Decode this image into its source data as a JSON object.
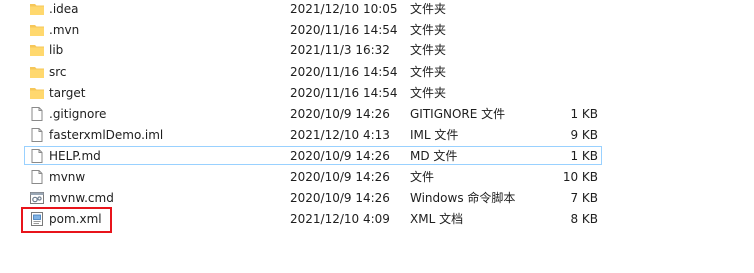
{
  "files": [
    {
      "name": ".idea",
      "date": "2021/12/10 10:05",
      "type": "文件夹",
      "size": "",
      "icon": "folder-icon"
    },
    {
      "name": ".mvn",
      "date": "2020/11/16 14:54",
      "type": "文件夹",
      "size": "",
      "icon": "folder-icon"
    },
    {
      "name": "lib",
      "date": "2021/11/3 16:32",
      "type": "文件夹",
      "size": "",
      "icon": "folder-icon"
    },
    {
      "name": "src",
      "date": "2020/11/16 14:54",
      "type": "文件夹",
      "size": "",
      "icon": "folder-icon"
    },
    {
      "name": "target",
      "date": "2020/11/16 14:54",
      "type": "文件夹",
      "size": "",
      "icon": "folder-icon"
    },
    {
      "name": ".gitignore",
      "date": "2020/10/9 14:26",
      "type": "GITIGNORE 文件",
      "size": "1 KB",
      "icon": "file-icon"
    },
    {
      "name": "fasterxmlDemo.iml",
      "date": "2021/12/10 4:13",
      "type": "IML 文件",
      "size": "9 KB",
      "icon": "file-icon"
    },
    {
      "name": "HELP.md",
      "date": "2020/10/9 14:26",
      "type": "MD 文件",
      "size": "1 KB",
      "icon": "file-icon"
    },
    {
      "name": "mvnw",
      "date": "2020/10/9 14:26",
      "type": "文件",
      "size": "10 KB",
      "icon": "file-icon"
    },
    {
      "name": "mvnw.cmd",
      "date": "2020/10/9 14:26",
      "type": "Windows 命令脚本",
      "size": "7 KB",
      "icon": "cmd-script-icon"
    },
    {
      "name": "pom.xml",
      "date": "2021/12/10 4:09",
      "type": "XML 文档",
      "size": "8 KB",
      "icon": "xml-document-icon"
    }
  ],
  "colors": {
    "folder": "#f6c75a",
    "focus_border": "#99d1ff",
    "highlight": "#e8141b",
    "text": "#1e1e1e"
  }
}
